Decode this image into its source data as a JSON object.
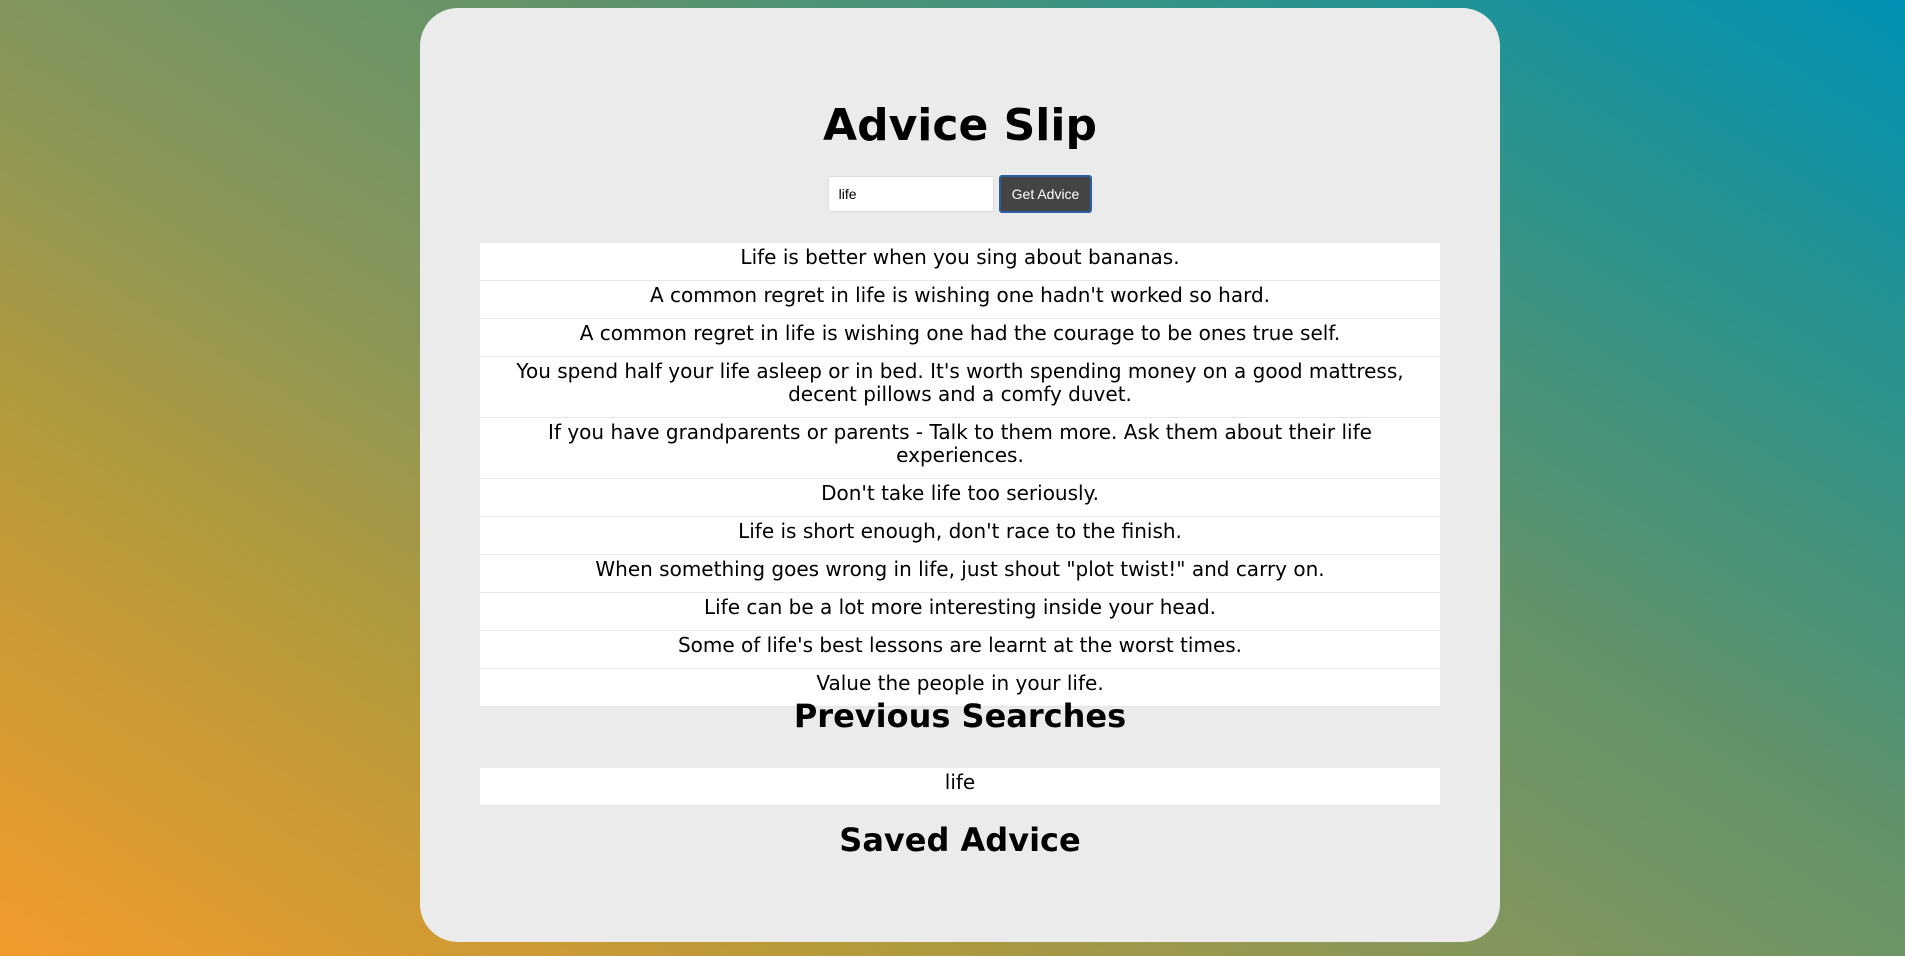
{
  "app": {
    "title": "Advice Slip"
  },
  "search": {
    "value": "life",
    "button_label": "Get Advice"
  },
  "advice": [
    "Life is better when you sing about bananas.",
    "A common regret in life is wishing one hadn't worked so hard.",
    "A common regret in life is wishing one had the courage to be ones true self.",
    "You spend half your life asleep or in bed. It's worth spending money on a good mattress, decent pillows and a comfy duvet.",
    "If you have grandparents or parents - Talk to them more. Ask them about their life experiences.",
    "Don't take life too seriously.",
    "Life is short enough, don't race to the finish.",
    "When something goes wrong in life, just shout \"plot twist!\" and carry on.",
    "Life can be a lot more interesting inside your head.",
    "Some of life's best lessons are learnt at the worst times.",
    "Value the people in your life."
  ],
  "previous": {
    "heading": "Previous Searches",
    "items": [
      "life"
    ]
  },
  "saved": {
    "heading": "Saved Advice"
  }
}
